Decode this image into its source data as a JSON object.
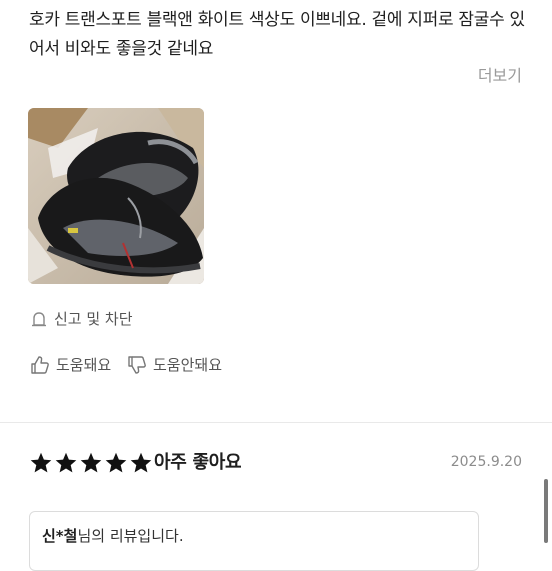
{
  "review": {
    "text": "호카 트랜스포트 블랙앤 화이트 색상도 이쁘네요. 겉에 지퍼로 잠굴수 있어서 비와도 좋을것 같네요",
    "more_label": "더보기",
    "photo_icon": "shoe-photo-thumbnail"
  },
  "actions": {
    "report_label": "신고 및 차단",
    "report_icon": "report-icon",
    "helpful_label": "도움돼요",
    "helpful_icon": "thumbs-up-icon",
    "unhelpful_label": "도움안돼요",
    "unhelpful_icon": "thumbs-down-icon"
  },
  "next_review": {
    "rating": 5,
    "rating_max": 5,
    "rating_label": "아주 좋아요",
    "date": "2025.9.20",
    "reviewer_masked_name": "신*철",
    "reviewer_suffix": "님의 리뷰입니다.",
    "star_color": "#111111"
  },
  "colors": {
    "text_primary": "#1f1f1f",
    "text_muted": "#9a9a9a",
    "divider": "#e9e9e9"
  }
}
